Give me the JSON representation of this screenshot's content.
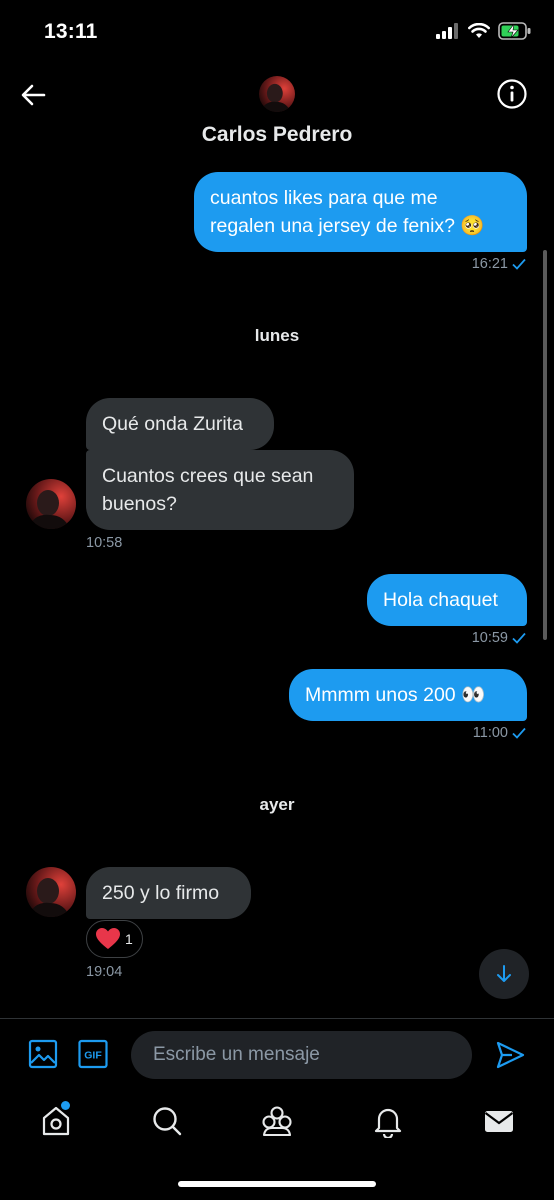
{
  "status_bar": {
    "time": "13:11"
  },
  "header": {
    "contact_name": "Carlos Pedrero"
  },
  "messages": {
    "m1": {
      "line1": "cuantos likes para que me",
      "line2": "regalen una jersey de fenix? 🥺",
      "time": "16:21"
    },
    "day1": "lunes",
    "m2": {
      "text": "Qué onda Zurita"
    },
    "m3": {
      "line1": "Cuantos crees que sean",
      "line2": "buenos?",
      "time": "10:58"
    },
    "m4": {
      "text": "Hola chaquet",
      "time": "10:59"
    },
    "m5": {
      "text": "Mmmm unos 200 👀",
      "time": "11:00"
    },
    "day2": "ayer",
    "m6": {
      "text": "250 y lo firmo",
      "time": "19:04",
      "reaction": {
        "emoji": "heart",
        "count": "1"
      }
    }
  },
  "composer": {
    "placeholder": "Escribe un mensaje"
  },
  "colors": {
    "accent": "#1d9bf0",
    "bubble_in": "#2f3336",
    "muted": "#8b98a5",
    "heart": "#f91880"
  },
  "icons": [
    "back-arrow-icon",
    "info-icon",
    "image-icon",
    "gif-icon",
    "send-icon",
    "home-icon",
    "search-icon",
    "communities-icon",
    "notifications-icon",
    "messages-icon",
    "arrow-down-icon"
  ]
}
